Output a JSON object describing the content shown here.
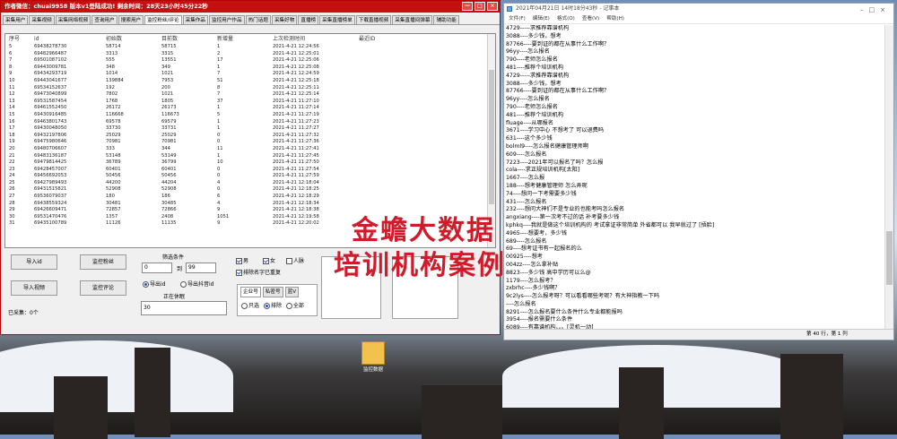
{
  "app": {
    "title": "作者微信：chuai9958 版本v1登陆成功! 剩余时间：28天23小时45分22秒",
    "tabs": [
      "采集用户",
      "采集视频",
      "采集网络视频",
      "查询用户",
      "搜索用户",
      "监控粉丝/评论",
      "采集作品",
      "监控用户作品",
      "热门话题",
      "采集好物",
      "直播榜",
      "采集直播榜单",
      "下载直播视频",
      "采集直播间弹幕",
      "辅助功能"
    ],
    "active_tab_index": 5,
    "table": {
      "headers": [
        "序号",
        "id",
        "初始数",
        "目前数",
        "新增量",
        "上次检测时间",
        "最近ID"
      ],
      "rows": [
        [
          "5",
          "69438278730",
          "58714",
          "58715",
          "1",
          "2021-4-21 12:24:56",
          ""
        ],
        [
          "6",
          "69482966487",
          "3313",
          "3315",
          "2",
          "2021-4-21 12:25:01",
          ""
        ],
        [
          "7",
          "69501087102",
          "555",
          "13551",
          "17",
          "2021-4-21 12:25:06",
          ""
        ],
        [
          "8",
          "69443009781",
          "348",
          "349",
          "1",
          "2021-4-21 12:25:08",
          ""
        ],
        [
          "9",
          "69434293719",
          "1014",
          "1021",
          "7",
          "2021-4-21 12:24:59",
          ""
        ],
        [
          "10",
          "69443041677",
          "139884",
          "7953",
          "51",
          "2021-4-21 12:25:18",
          ""
        ],
        [
          "11",
          "69534152637",
          "192",
          "200",
          "8",
          "2021-4-21 12:25:11",
          ""
        ],
        [
          "12",
          "69473040899",
          "7802",
          "1021",
          "7",
          "2021-4-21 12:25:14",
          ""
        ],
        [
          "13",
          "69531587454",
          "1768",
          "1805",
          "37",
          "2021-4-21 11:27:10",
          ""
        ],
        [
          "14",
          "69461552450",
          "26172",
          "26173",
          "1",
          "2021-4-21 11:27:14",
          ""
        ],
        [
          "15",
          "69430916485",
          "116668",
          "116673",
          "5",
          "2021-4-21 11:27:19",
          ""
        ],
        [
          "16",
          "69463801743",
          "69578",
          "69579",
          "1",
          "2021-4-21 11:27:23",
          ""
        ],
        [
          "17",
          "69430048050",
          "33730",
          "33731",
          "1",
          "2021-4-21 11:27:27",
          ""
        ],
        [
          "18",
          "69432197806",
          "25029",
          "25029",
          "0",
          "2021-4-21 11:27:32",
          ""
        ],
        [
          "19",
          "69475980646",
          "70981",
          "70981",
          "0",
          "2021-4-21 11:27:36",
          ""
        ],
        [
          "20",
          "69480706607",
          "333",
          "344",
          "11",
          "2021-4-21 11:27:41",
          ""
        ],
        [
          "21",
          "69483136187",
          "53148",
          "53149",
          "1",
          "2021-4-21 11:27:45",
          ""
        ],
        [
          "22",
          "69479814425",
          "36789",
          "36799",
          "10",
          "2021-4-21 11:27:50",
          ""
        ],
        [
          "23",
          "69428457007",
          "60401",
          "60401",
          "0",
          "2021-4-21 11:27:54",
          ""
        ],
        [
          "24",
          "69456692053",
          "50456",
          "50456",
          "0",
          "2021-4-21 11:27:59",
          ""
        ],
        [
          "25",
          "69427989493",
          "44200",
          "44204",
          "4",
          "2021-4-21 12:18:04",
          ""
        ],
        [
          "26",
          "69431515821",
          "52908",
          "52908",
          "0",
          "2021-4-21 12:18:25",
          ""
        ],
        [
          "27",
          "69536079037",
          "180",
          "186",
          "6",
          "2021-4-21 12:18:29",
          ""
        ],
        [
          "28",
          "69438559324",
          "30481",
          "30485",
          "4",
          "2021-4-21 12:18:34",
          ""
        ],
        [
          "29",
          "69426609471",
          "72857",
          "72866",
          "9",
          "2021-4-21 12:18:38",
          ""
        ],
        [
          "30",
          "69531470476",
          "1357",
          "2408",
          "1051",
          "2021-4-21 12:19:58",
          ""
        ],
        [
          "31",
          "69435100789",
          "11126",
          "11135",
          "9",
          "2021-4-21 12:20:02",
          ""
        ]
      ]
    },
    "controls": {
      "import_id": "导入id",
      "monitor_fans": "监控粉丝",
      "import_video": "导入视频",
      "monitor_comment": "监控评论",
      "filter_label": "筛选条件",
      "from_value": "0",
      "to_label": "到",
      "to_value": "99",
      "export_id": "导出id",
      "export_douyin": "导出抖音id",
      "status_label": "正在休眠",
      "sleep_value": "30",
      "male": "男",
      "female": "女",
      "person": "人脉",
      "exclude": "排除名字已重复",
      "seg_tabs": [
        "企业号",
        "私密号",
        "蓝V"
      ],
      "radio_only": "只选",
      "radio_exclude": "排除",
      "radio_all": "全部",
      "acquired": "已采集：0个"
    }
  },
  "notepad": {
    "title": "2021年04月21日 14时18分43秒 - 记事本",
    "menu": [
      "文件(F)",
      "编辑(E)",
      "格式(O)",
      "查看(V)",
      "帮助(H)"
    ],
    "lines": [
      "4729-----求推荐靠谱机构",
      "3088----多少钱，想考",
      "87766----要到证的都在从事什么工作啊？",
      "96yy----怎么报名",
      "790----老师怎么报名",
      "481----推荐个培训机构",
      "4729-----求推荐靠谱机构",
      "3088----多少钱，想考",
      "87766----要到证的都在从事什么工作啊？",
      "96yy----怎么报名",
      "790----老师怎么报名",
      "481----推荐个培训机构",
      "fluage----从哪报名",
      "3671----学习中心 不想考了 可以退费吗",
      "631----这个多少钱",
      "bolml9----怎么报名健康管理师啊",
      "609----怎么报名",
      "7223----2021年可以报名了吗？怎么报",
      "cola----求正规培训机构[太阳]",
      "1667----怎么报",
      "188----想考健康管理师 怎么弄呢",
      "74----想问一下考需要多少钱",
      "431----怎么报名",
      "232----想问大神们不是专业的也能考吗怎么报名",
      "angxiang----第一次考不过的话 补考要多少钱",
      "kphkq----我就是做这个培训机构的 考试拿证非常简单 外省都可以 我早就过了 [捂脸]",
      "4965----想要考，多少钱",
      "689----怎么报名",
      "69----想考证书有一起报名的么",
      "00925----想考",
      "004zz----怎么拿补贴",
      "8823----多少钱 高中学历可以么@",
      "1179----怎么报考？",
      "zxbrhc----多少钱啊？",
      "9c2lys----怎么报考呀？可以看看哪些考呢？有大神指教一下吗",
      "----怎么报名",
      "8291----怎么报名要什么条件什么专业都能报吗",
      "3954----报名需要什么条件",
      "6089----有靠谱机构。。。[灵机一动]"
    ],
    "status": "第 40 行，第 1 列"
  },
  "watermark": {
    "line1": "金蟾大数据",
    "line2": "培训机构案例"
  },
  "desktop": {
    "icon_label": "监控数据"
  }
}
